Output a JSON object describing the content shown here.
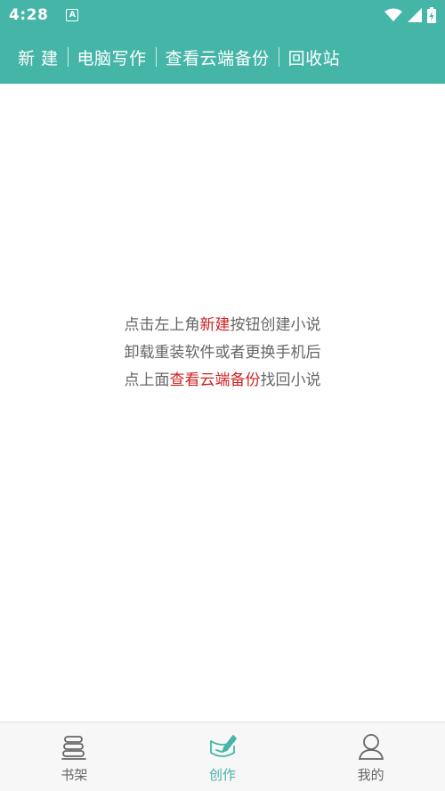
{
  "status_bar": {
    "time": "4:28",
    "notification_glyph": "A",
    "icons": [
      "wifi-icon",
      "signal-icon",
      "battery-charging-icon"
    ]
  },
  "toolbar": {
    "items": [
      "新 建",
      "电脑写作",
      "查看云端备份",
      "回收站"
    ]
  },
  "hint": {
    "line1": {
      "before": "点击左上角",
      "highlight": "新建",
      "after": "按钮创建小说"
    },
    "line2": "卸载重装软件或者更换手机后",
    "line3": {
      "before": "点上面",
      "highlight": "查看云端备份",
      "after": "找回小说"
    }
  },
  "bottom_nav": {
    "items": [
      {
        "label": "书架",
        "icon": "bookshelf-icon",
        "active": false
      },
      {
        "label": "创作",
        "icon": "write-icon",
        "active": true
      },
      {
        "label": "我的",
        "icon": "profile-icon",
        "active": false
      }
    ]
  },
  "colors": {
    "accent": "#45b5a8",
    "highlight": "#cc2222",
    "text": "#666666"
  }
}
